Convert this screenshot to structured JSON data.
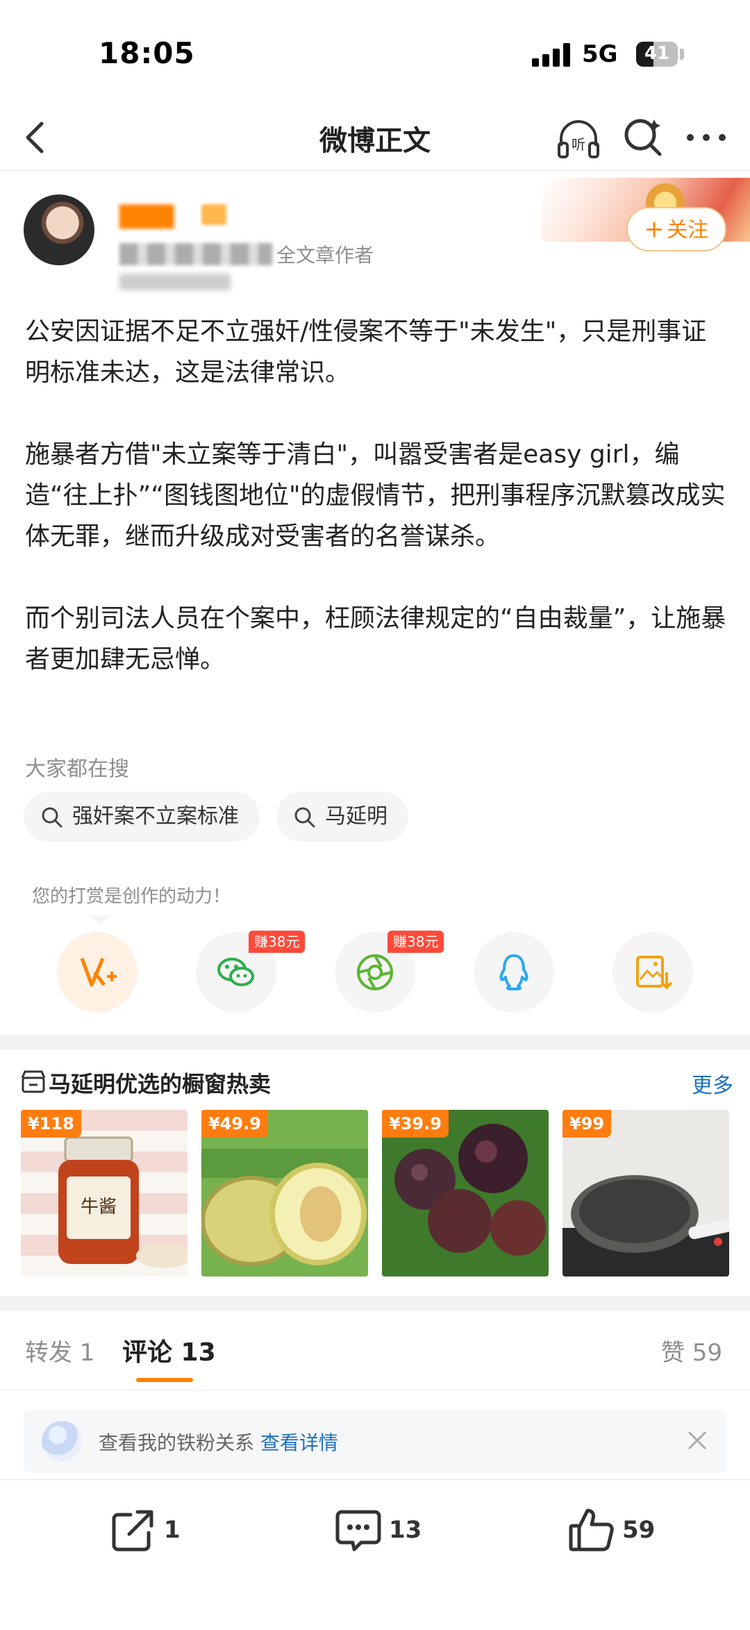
{
  "status_bar": {
    "time": "18:05",
    "network": "5G",
    "battery": "41",
    "battery_level": 0.41
  },
  "nav": {
    "title": "微博正文"
  },
  "author": {
    "role_label": "全文章作者",
    "follow_label": "关注"
  },
  "post": {
    "paragraphs": [
      "公安因证据不足不立强奸/性侵案不等于\"未发生\"，只是刑事证明标准未达，这是法律常识。",
      "施暴者方借\"未立案等于清白\"，叫嚣受害者是easy girl，编造“往上扑”“图钱图地位\"的虚假情节，把刑事程序沉默篡改成实体无罪，继而升级成对受害者的名誉谋杀。",
      "而个别司法人员在个案中，枉顾法律规定的“自由裁量”，让施暴者更加肆无忌惮。"
    ]
  },
  "search": {
    "label": "大家都在搜",
    "chips": [
      "强奸案不立案标准",
      "马延明"
    ]
  },
  "reward": {
    "label": "您的打赏是创作的动力！",
    "earn_tag": "赚38元"
  },
  "shop": {
    "title": "马延明优选的橱窗热卖",
    "more": "更多",
    "products": [
      {
        "price": "¥118",
        "icon": "chili-sauce-jar"
      },
      {
        "price": "¥49.9",
        "icon": "melon"
      },
      {
        "price": "¥39.9",
        "icon": "tomatoes"
      },
      {
        "price": "¥99",
        "icon": "frying-pan"
      }
    ]
  },
  "tabs": {
    "repost": "转发 1",
    "comment": "评论 13",
    "like": "赞 59"
  },
  "fan_bar": {
    "text": "查看我的铁粉关系",
    "link": "查看详情"
  },
  "bottom_bar": {
    "repost_count": "1",
    "comment_count": "13",
    "like_count": "59"
  },
  "colors": {
    "accent": "#ff8200",
    "link": "#1e6fbf",
    "earn_red": "#ff4a3a"
  }
}
